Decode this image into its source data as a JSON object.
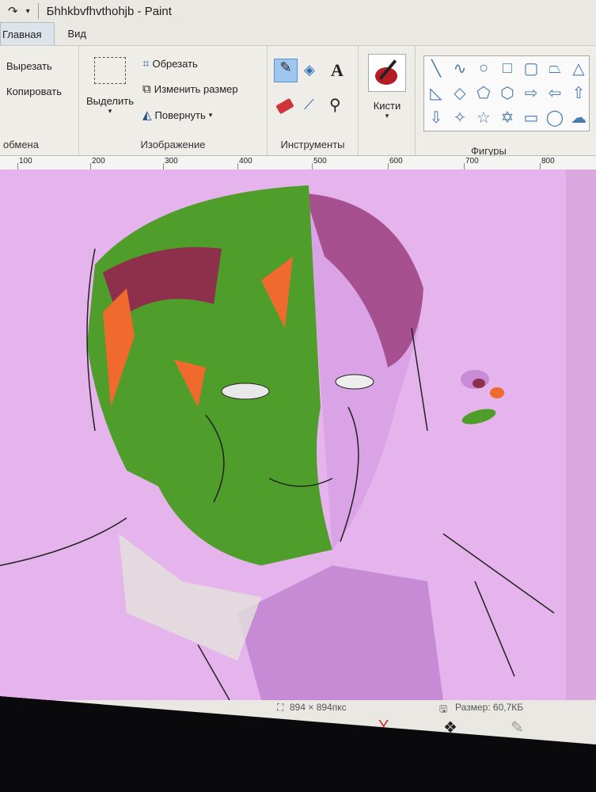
{
  "window": {
    "title": "Бhhkbvfhvthohjb - Paint"
  },
  "tabs": [
    {
      "label": "Главная",
      "active": true
    },
    {
      "label": "Вид",
      "active": false
    }
  ],
  "ribbon": {
    "clipboard": {
      "cut": "Вырезать",
      "copy": "Копировать",
      "group": "обмена"
    },
    "image": {
      "select": "Выделить",
      "crop": "Обрезать",
      "resize": "Изменить размер",
      "rotate": "Повернуть",
      "group": "Изображение"
    },
    "tools": {
      "group": "Инструменты",
      "text_glyph": "A"
    },
    "brushes": {
      "label": "Кисти"
    },
    "shapes": {
      "group": "Фигуры"
    }
  },
  "ruler": {
    "ticks": [
      "100",
      "200",
      "300",
      "400",
      "500",
      "600",
      "700",
      "800"
    ]
  },
  "colors": {
    "canvas_bg": "#e6b4ec",
    "green": "#4f9d2b",
    "purple": "#c78bd6",
    "hair_red": "#8e2f4c",
    "orange": "#ef6a2c"
  },
  "status": {
    "dimensions": "894 × 894пкс",
    "size": "Размер: 60,7КБ"
  }
}
